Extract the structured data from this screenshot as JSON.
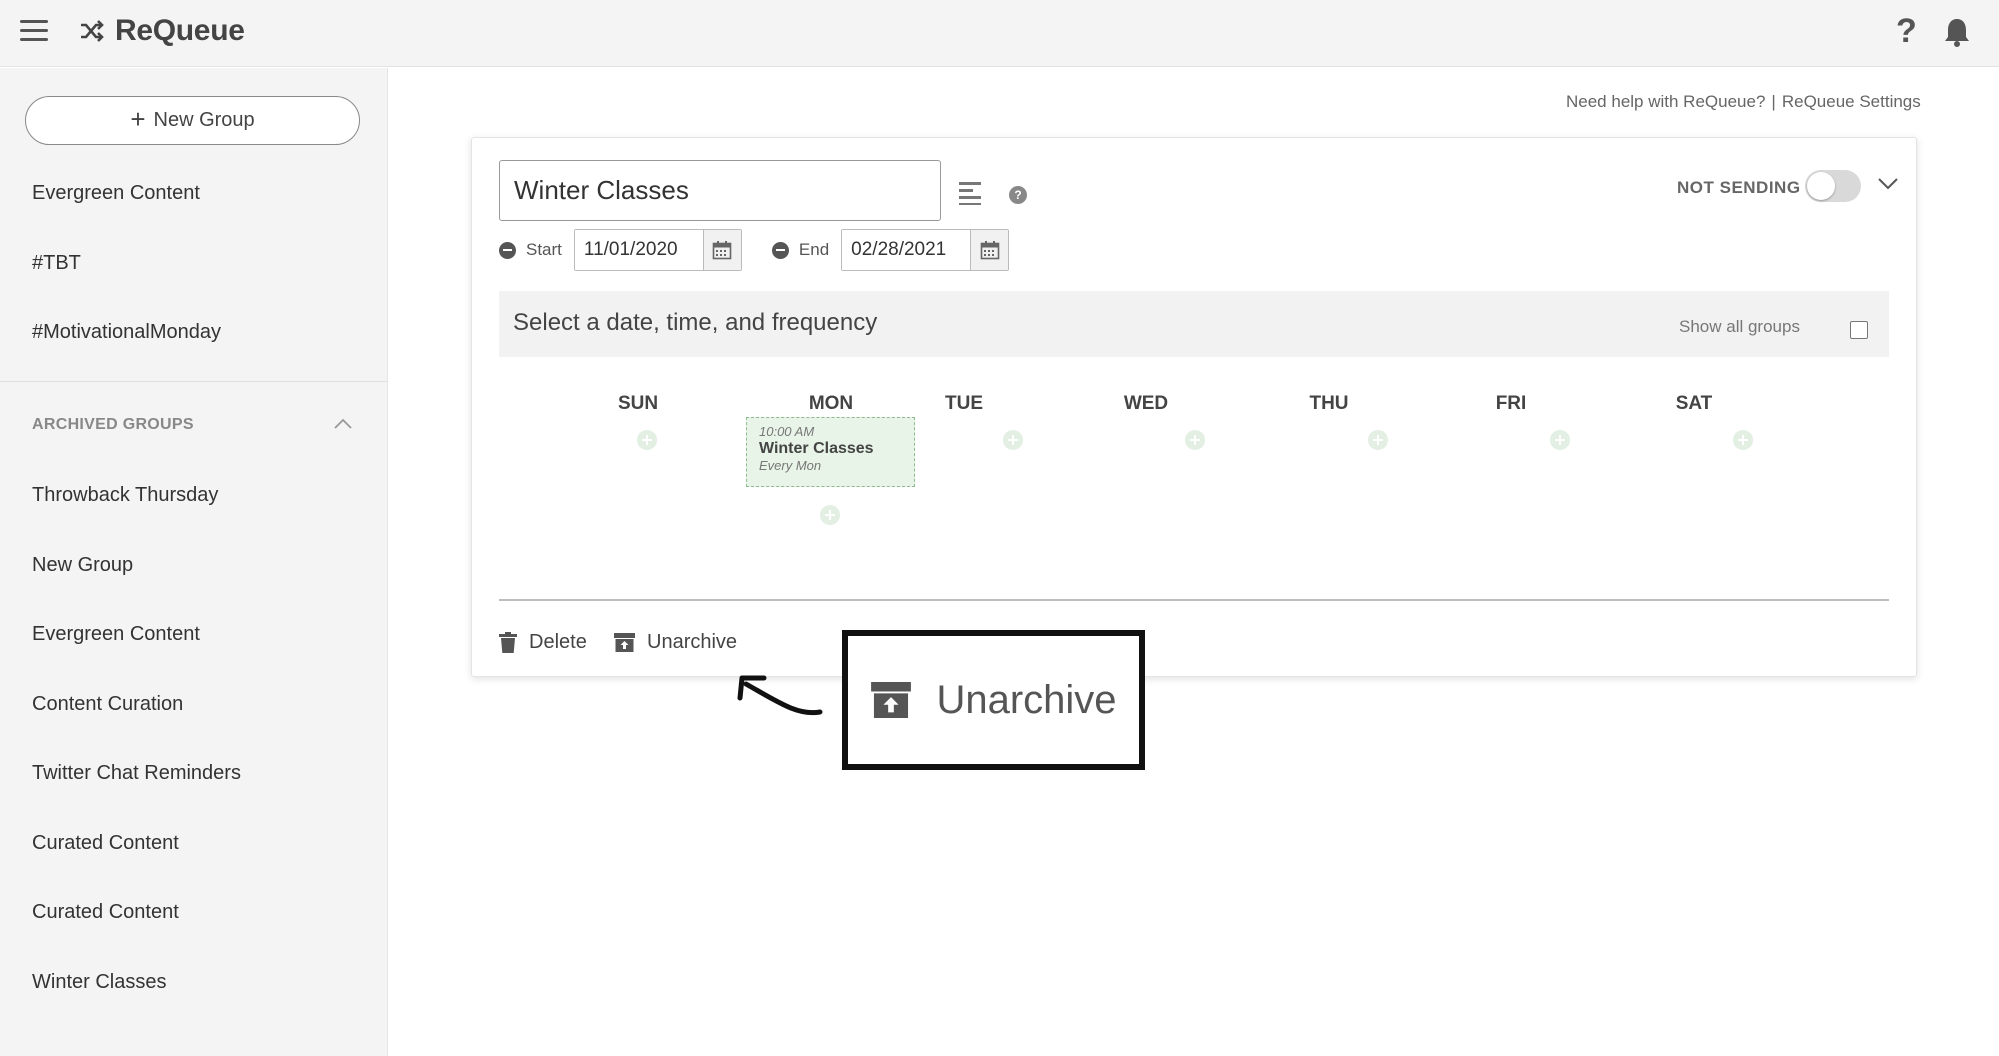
{
  "app": {
    "name": "ReQueue"
  },
  "header": {
    "menu_icon": "hamburger-menu-icon",
    "logo_icon": "shuffle-icon",
    "help_icon_glyph": "?",
    "notifications_icon": "bell-icon"
  },
  "sidebar": {
    "new_group_label": "New Group",
    "groups": [
      {
        "label": "Evergreen Content"
      },
      {
        "label": "#TBT"
      },
      {
        "label": "#MotivationalMonday"
      }
    ],
    "archived_header": "ARCHIVED GROUPS",
    "archived": [
      {
        "label": "Throwback Thursday"
      },
      {
        "label": "New Group"
      },
      {
        "label": "Evergreen Content"
      },
      {
        "label": "Content Curation"
      },
      {
        "label": "Twitter Chat Reminders"
      },
      {
        "label": "Curated Content"
      },
      {
        "label": "Curated Content"
      },
      {
        "label": "Winter Classes"
      }
    ]
  },
  "top_links": {
    "help": "Need help with ReQueue?",
    "separator": "|",
    "settings": "ReQueue Settings"
  },
  "group_card": {
    "name_value": "Winter Classes",
    "help_glyph": "?",
    "status_label": "NOT SENDING",
    "sending": false,
    "start_label": "Start",
    "start_date": "11/01/2020",
    "end_label": "End",
    "end_date": "02/28/2021",
    "frequency_title": "Select a date, time, and frequency",
    "show_all_groups_label": "Show all groups",
    "show_all_groups_checked": false,
    "days": [
      "SUN",
      "MON",
      "TUE",
      "WED",
      "THU",
      "FRI",
      "SAT"
    ],
    "slot": {
      "time": "10:00 AM",
      "name": "Winter Classes",
      "frequency": "Every Mon"
    },
    "delete_label": "Delete",
    "unarchive_label": "Unarchive"
  },
  "annotation": {
    "label": "Unarchive",
    "icon": "archive-box-icon"
  },
  "colors": {
    "topbar_bg": "#f4f4f4",
    "sidebar_bg": "#f4f4f4",
    "slot_bg": "#e8f4e8",
    "slot_border": "#8cbb8c",
    "toggle_off": "#d9d9d9"
  }
}
